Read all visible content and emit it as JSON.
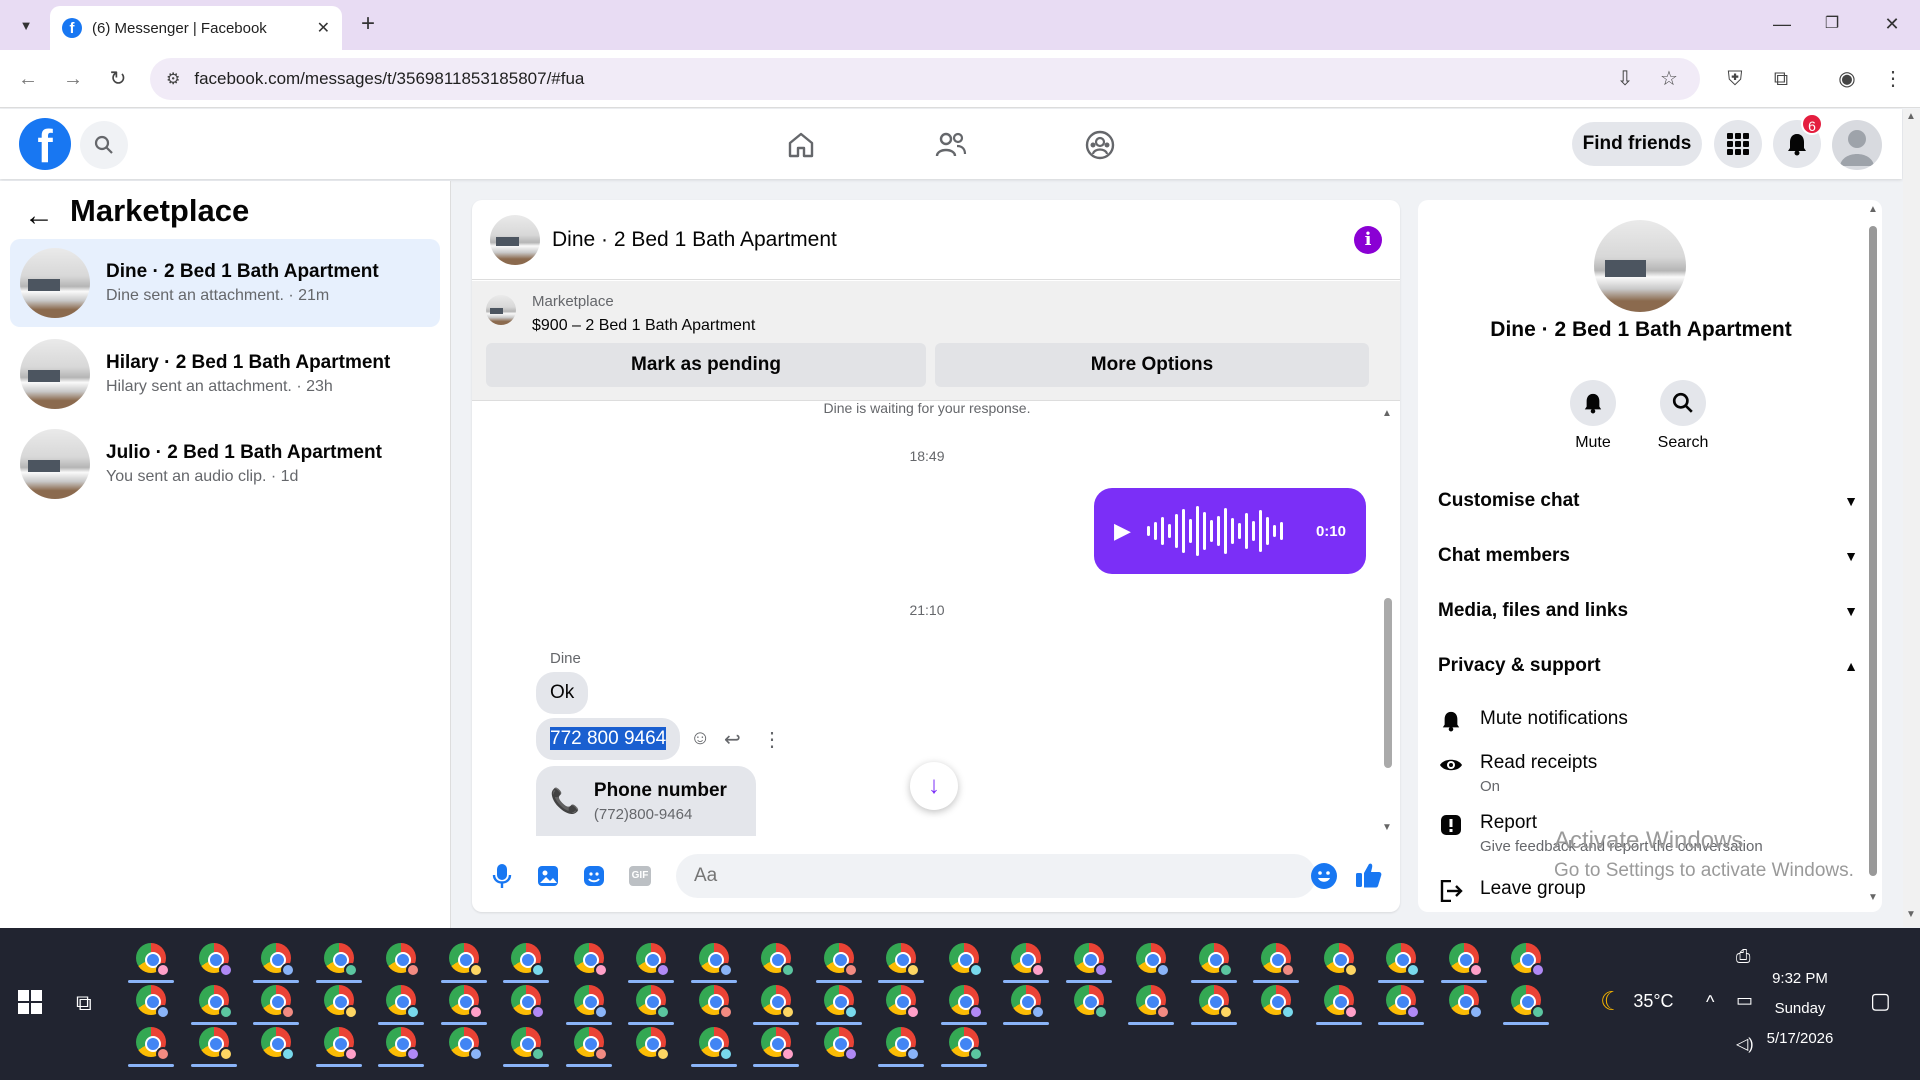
{
  "browser": {
    "tab_title": "(6) Messenger | Facebook",
    "url": "facebook.com/messages/t/3569811853185807/#fua"
  },
  "fb_header": {
    "find_friends": "Find friends",
    "notification_count": "6"
  },
  "left_panel": {
    "title": "Marketplace",
    "conversations": [
      {
        "name": "Dine · 2 Bed 1 Bath Apartment",
        "preview": "Dine sent an attachment. · 21m",
        "active": true
      },
      {
        "name": "Hilary · 2 Bed 1 Bath Apartment",
        "preview": "Hilary sent an attachment. · 23h",
        "active": false
      },
      {
        "name": "Julio · 2 Bed 1 Bath Apartment",
        "preview": "You sent an audio clip. · 1d",
        "active": false
      }
    ]
  },
  "chat": {
    "title": "Dine · 2 Bed 1 Bath Apartment",
    "marketplace_label": "Marketplace",
    "listing": "$900 – 2 Bed 1 Bath Apartment",
    "mark_pending": "Mark as pending",
    "more_options": "More Options",
    "waiting_notice": "Dine is waiting for your response.",
    "time_1": "18:49",
    "audio_duration": "0:10",
    "time_2": "21:10",
    "sender": "Dine",
    "msg_1": "Ok",
    "msg_2": "772 800 9464",
    "phone_card_label": "Phone number",
    "phone_card_number": "(772)800-9464",
    "input_placeholder": "Aa"
  },
  "right_panel": {
    "title": "Dine · 2 Bed 1 Bath Apartment",
    "mute": "Mute",
    "search": "Search",
    "sections": [
      "Customise chat",
      "Chat members",
      "Media, files and links",
      "Privacy & support"
    ],
    "options": {
      "mute_notifications": "Mute notifications",
      "read_receipts": "Read receipts",
      "read_receipts_state": "On",
      "report": "Report",
      "report_sub": "Give feedback and report the conversation",
      "leave_group": "Leave group"
    }
  },
  "watermark": {
    "line1": "Activate Windows",
    "line2": "Go to Settings to activate Windows."
  },
  "taskbar": {
    "temperature": "35°C",
    "time": "9:32 PM",
    "day": "Sunday",
    "date": "5/17/2026"
  },
  "colors": {
    "facebook_blue": "#1877f2",
    "messenger_purple": "#7b2ff7",
    "active_conversation_bg": "#e7f0fd",
    "badge_red": "#e41e3f"
  }
}
